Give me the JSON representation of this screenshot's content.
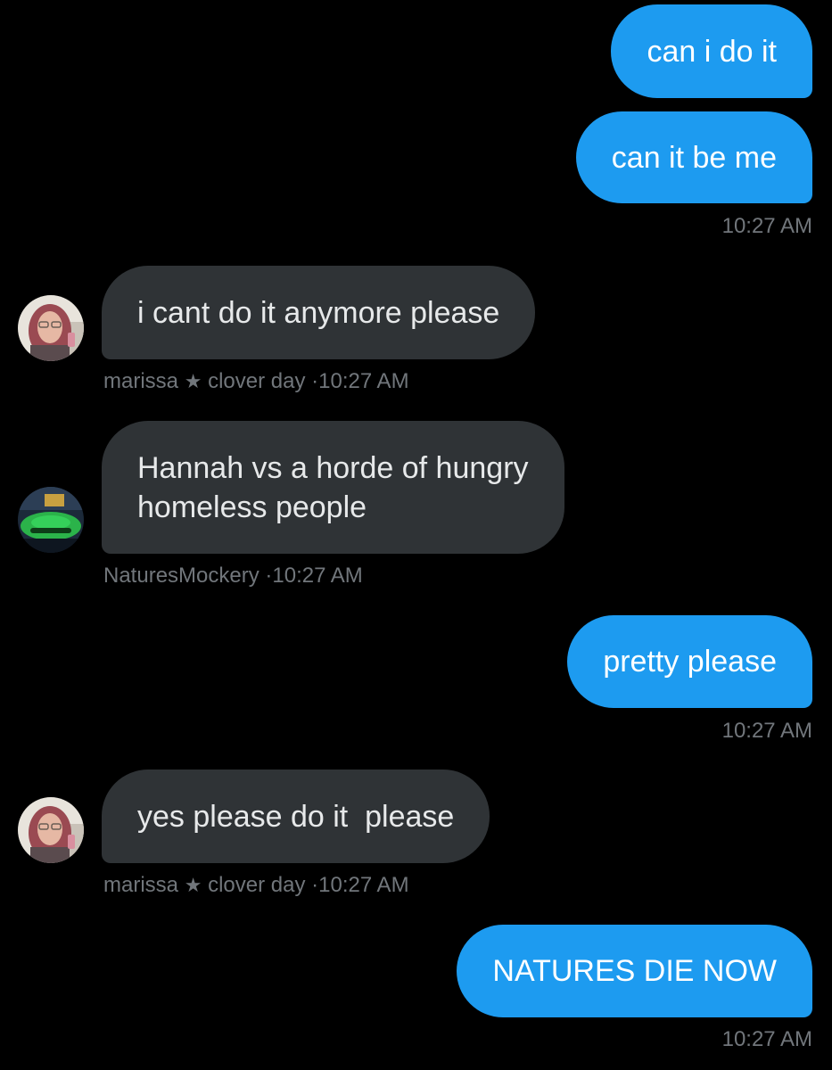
{
  "messages": [
    {
      "direction": "outgoing",
      "text": "can i do it"
    },
    {
      "direction": "outgoing",
      "text": "can it be me",
      "time": "10:27 AM"
    },
    {
      "direction": "incoming",
      "sender": "marissa",
      "sender_suffix": "clover day",
      "text": "i cant do it anymore please",
      "time": "10:27 AM"
    },
    {
      "direction": "incoming",
      "sender": "NaturesMockery",
      "lines": [
        "Hannah vs a horde of hungry",
        "homeless people"
      ],
      "time": "10:27 AM"
    },
    {
      "direction": "outgoing",
      "text": "pretty please",
      "time": "10:27 AM"
    },
    {
      "direction": "incoming",
      "sender": "marissa",
      "sender_suffix": "clover day",
      "text": "yes please do it  please",
      "time": "10:27 AM"
    },
    {
      "direction": "outgoing",
      "text": "NATURES DIE NOW",
      "time": "10:27 AM"
    }
  ],
  "separator": "·",
  "star": "★",
  "icons": {
    "marissa_avatar": "avatar-photo-marissa",
    "naturesmockery_avatar": "avatar-photo-green-car"
  },
  "colors": {
    "background": "#000000",
    "outgoing_bubble": "#1d9bf0",
    "incoming_bubble": "#2f3336",
    "meta_text": "#71767b"
  }
}
